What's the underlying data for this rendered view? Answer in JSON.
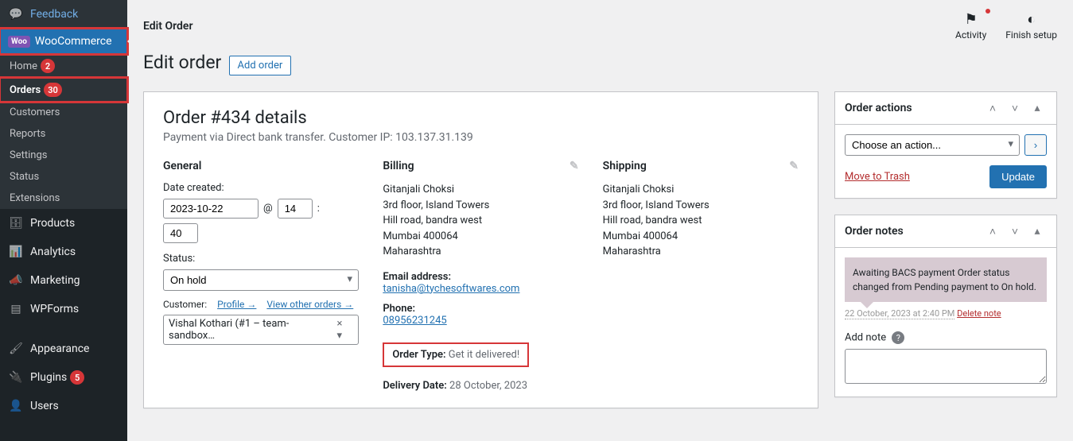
{
  "sidebar": {
    "feedback": "Feedback",
    "woocommerce": "WooCommerce",
    "woo_badge": "Woo",
    "submenu": {
      "home": "Home",
      "home_badge": "2",
      "orders": "Orders",
      "orders_badge": "30",
      "customers": "Customers",
      "reports": "Reports",
      "settings": "Settings",
      "status": "Status",
      "extensions": "Extensions"
    },
    "products": "Products",
    "analytics": "Analytics",
    "marketing": "Marketing",
    "wpforms": "WPForms",
    "appearance": "Appearance",
    "plugins": "Plugins",
    "plugins_badge": "5",
    "users": "Users"
  },
  "topbar": {
    "title": "Edit Order",
    "activity": "Activity",
    "finish": "Finish setup"
  },
  "page": {
    "heading": "Edit order",
    "add_order": "Add order"
  },
  "order": {
    "title": "Order #434 details",
    "subtitle": "Payment via Direct bank transfer. Customer IP: 103.137.31.139",
    "general": {
      "heading": "General",
      "date_label": "Date created:",
      "date": "2023-10-22",
      "hour": "14",
      "minute": "40",
      "status_label": "Status:",
      "status": "On hold",
      "customer_label": "Customer:",
      "profile_link": "Profile →",
      "view_orders_link": "View other orders →",
      "customer": "Vishal Kothari (#1 – team-sandbox…"
    },
    "billing": {
      "heading": "Billing",
      "name": "Gitanjali Choksi",
      "line1": "3rd floor, Island Towers",
      "line2": "Hill road, bandra west",
      "line3": "Mumbai 400064",
      "line4": "Maharashtra",
      "email_label": "Email address:",
      "email": "tanisha@tychesoftwares.com",
      "phone_label": "Phone:",
      "phone": "08956231245",
      "order_type_label": "Order Type:",
      "order_type": "Get it delivered!",
      "delivery_label": "Delivery Date:",
      "delivery": "28 October, 2023"
    },
    "shipping": {
      "heading": "Shipping",
      "name": "Gitanjali Choksi",
      "line1": "3rd floor, Island Towers",
      "line2": "Hill road, bandra west",
      "line3": "Mumbai 400064",
      "line4": "Maharashtra"
    }
  },
  "actions": {
    "heading": "Order actions",
    "choose": "Choose an action...",
    "trash": "Move to Trash",
    "update": "Update"
  },
  "notes": {
    "heading": "Order notes",
    "note1": "Awaiting BACS payment Order status changed from Pending payment to On hold.",
    "meta": "22 October, 2023 at 2:40 PM",
    "delete": "Delete note",
    "add_label": "Add note"
  }
}
